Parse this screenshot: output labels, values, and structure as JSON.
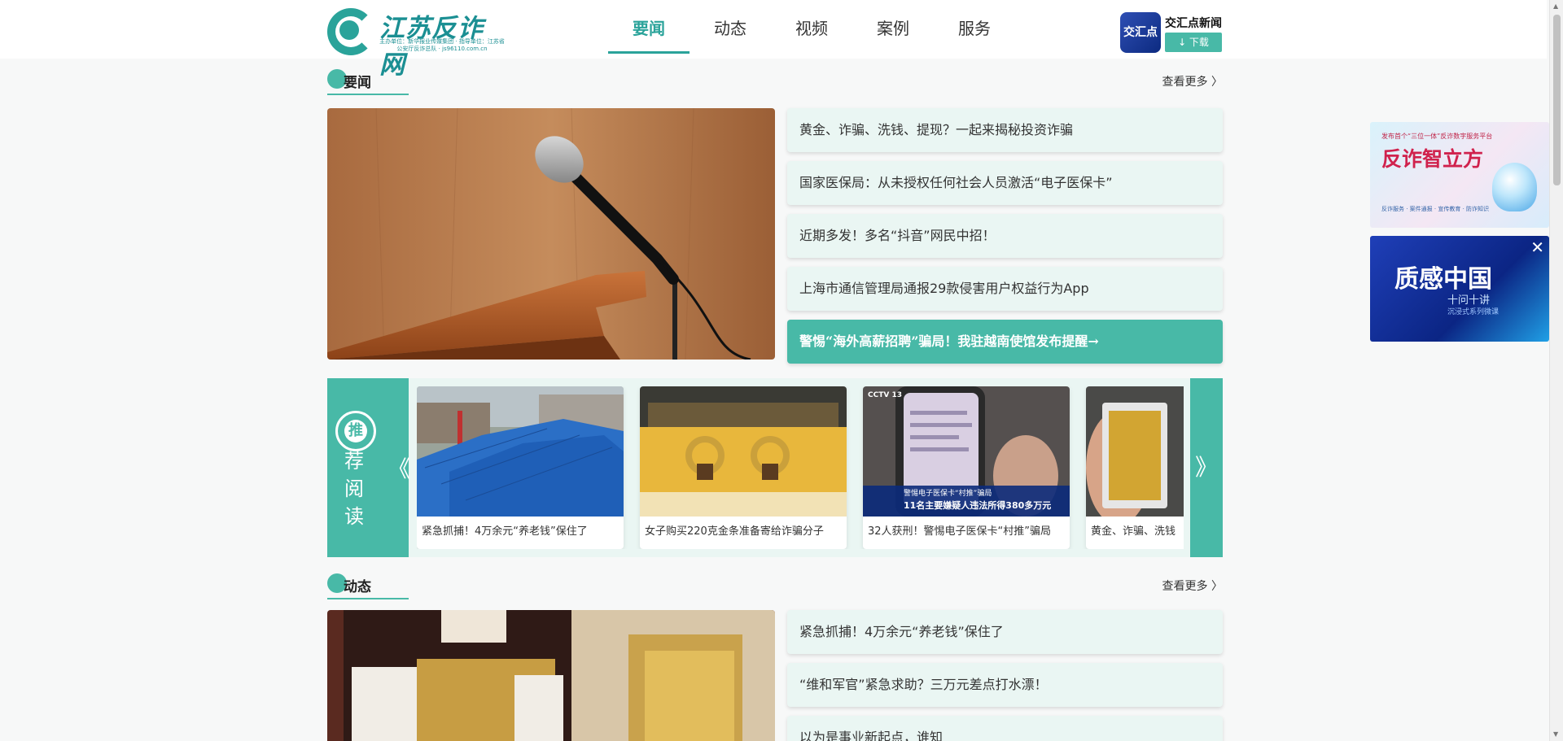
{
  "logo": {
    "title": "江苏反诈网",
    "subtitle": "主办单位：新华报业传媒集团 · 指导单位：江苏省公安厅反诈总队 · js96110.com.cn"
  },
  "nav": {
    "items": [
      "要闻",
      "动态",
      "视频",
      "案例",
      "服务"
    ],
    "active": "要闻"
  },
  "app": {
    "icon_text": "交汇点",
    "name": "交汇点新闻",
    "download_label": "↓ 下载"
  },
  "headline_section": {
    "title": "要闻",
    "more_label": "查看更多 〉",
    "items": [
      "黄金、诈骗、洗钱、提现？一起来揭秘投资诈骗",
      "国家医保局：从未授权任何社会人员激活“电子医保卡”",
      "近期多发！多名“抖音”网民中招！",
      "上海市通信管理局通报29款侵害用户权益行为App",
      "警惕“海外高薪招聘”骗局！我驻越南使馆发布提醒→"
    ]
  },
  "recommend": {
    "badge": "推",
    "label": "荐阅读",
    "prev_label": "《",
    "next_label": "》",
    "cards": [
      {
        "caption": "紧急抓捕！4万余元“养老钱”保住了",
        "image": "blue-tent-street"
      },
      {
        "caption": "女子购买220克金条准备寄给诈骗分子",
        "image": "gold-bracelets"
      },
      {
        "caption": "32人获刑！警惕电子医保卡“村推”骗局",
        "image": "phone-news-screen",
        "overlay_title": "警惕电子医保卡“村推”骗局",
        "overlay_text": "11名主要嫌疑人违法所得380多万元",
        "channel": "CCTV 13"
      },
      {
        "caption": "黄金、诈骗、洗钱",
        "image": "gold-bar-hand"
      }
    ]
  },
  "dynamic_section": {
    "title": "动态",
    "more_label": "查看更多 〉",
    "items": [
      "紧急抓捕！4万余元“养老钱”保住了",
      "“维和军官”紧急求助？三万元差点打水漂！",
      "以为是事业新起点，谁知"
    ]
  },
  "ads": {
    "ad1": {
      "small": "发布首个“三位一体”反诈数字服务平台",
      "title": "反诈智立方",
      "foot": "反诈服务 · 案件通报 · 宣传教育 · 防诈知识"
    },
    "ad2": {
      "title": "质感中国",
      "sub": "十问十讲",
      "foot": "沉浸式系列微课",
      "close": "✕"
    }
  }
}
